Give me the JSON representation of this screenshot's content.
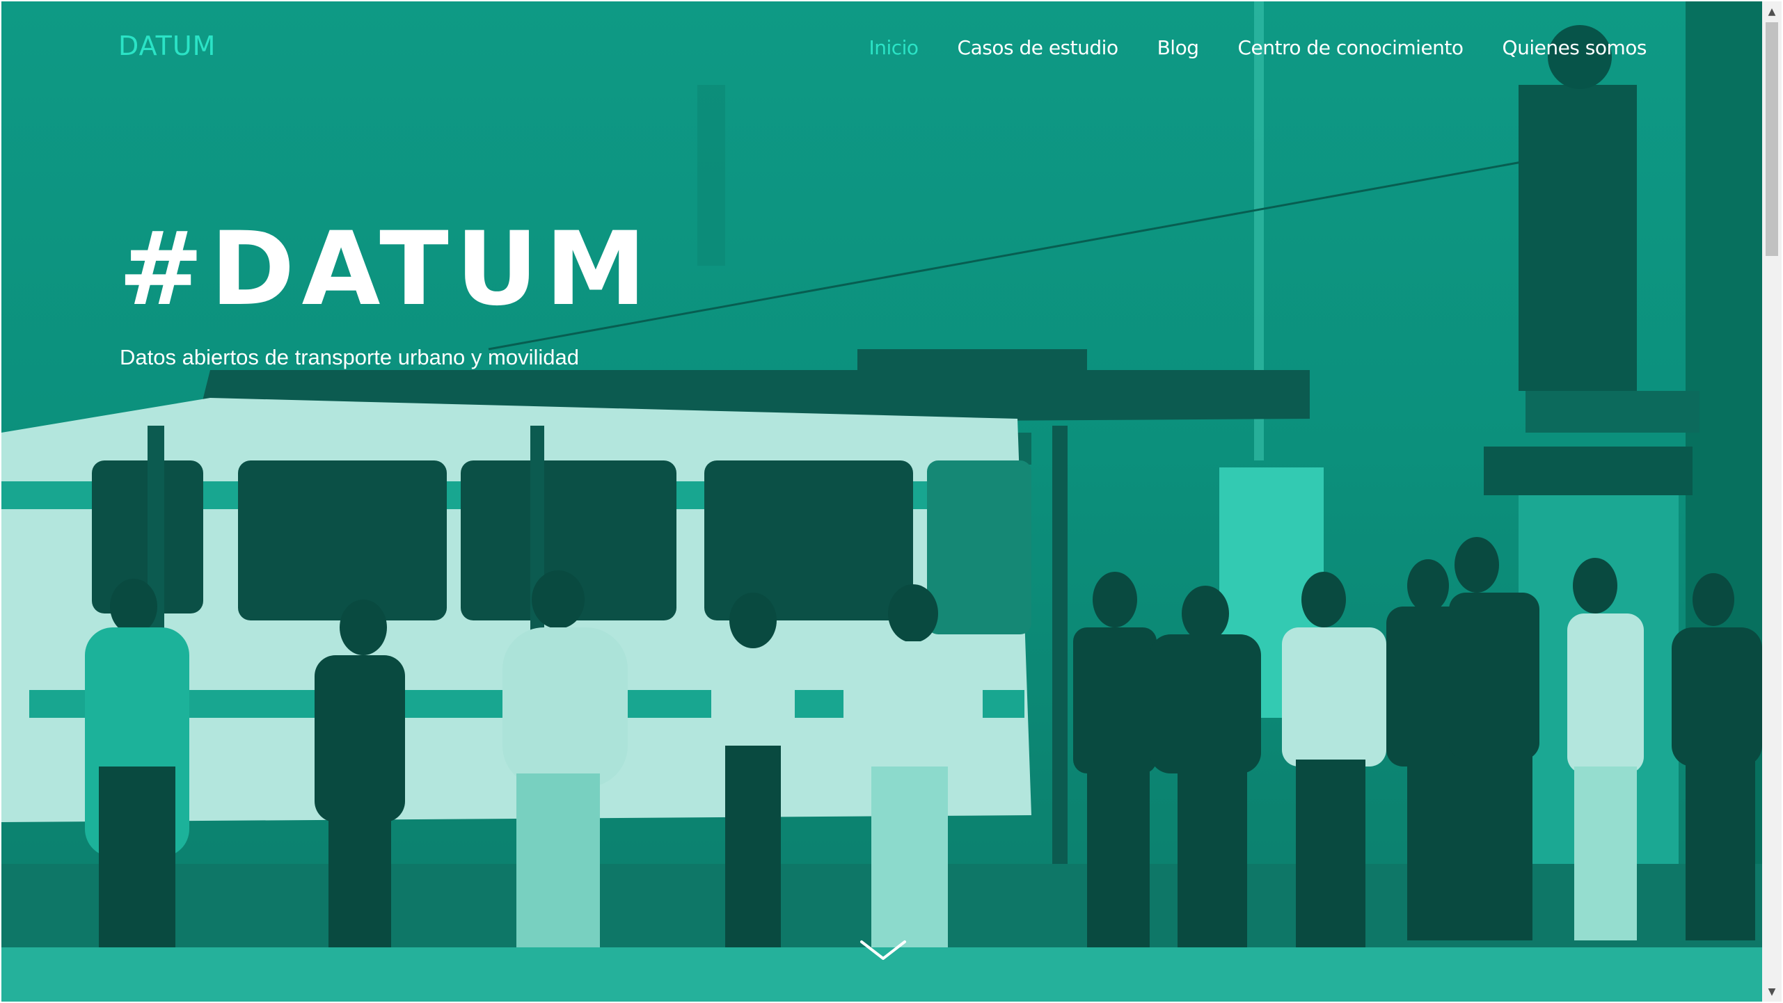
{
  "navbar": {
    "brand": "DATUM",
    "items": [
      {
        "label": "Inicio",
        "active": true
      },
      {
        "label": "Casos de estudio",
        "active": false
      },
      {
        "label": "Blog",
        "active": false
      },
      {
        "label": "Centro de conocimiento",
        "active": false
      },
      {
        "label": "Quienes somos",
        "active": false
      }
    ]
  },
  "hero": {
    "title": "#DATUM",
    "subtitle": "Datos abiertos de transporte urbano y movilidad",
    "background_image": "people queueing at a bus stop beside a bus and a statue, teal duotone",
    "scroll_icon": "chevron-down-icon"
  },
  "theme": {
    "accent": "#2be3c6",
    "overlay": "#0d8a78",
    "text": "#ffffff"
  },
  "scrollbar": {
    "up_icon": "triangle-up-icon",
    "down_icon": "triangle-down-icon"
  }
}
